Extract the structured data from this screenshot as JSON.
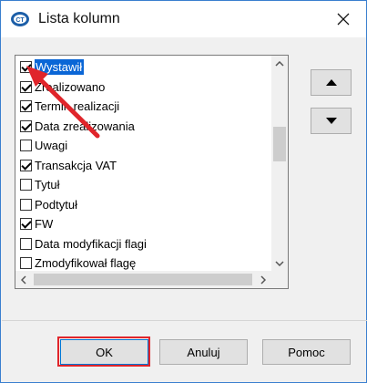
{
  "window": {
    "title": "Lista kolumn"
  },
  "columns": [
    {
      "label": "Wystawił",
      "checked": true,
      "selected": true
    },
    {
      "label": "Zrealizowano",
      "checked": true,
      "selected": false
    },
    {
      "label": "Termin realizacji",
      "checked": true,
      "selected": false
    },
    {
      "label": "Data zrealizowania",
      "checked": true,
      "selected": false
    },
    {
      "label": "Uwagi",
      "checked": false,
      "selected": false
    },
    {
      "label": "Transakcja VAT",
      "checked": true,
      "selected": false
    },
    {
      "label": "Tytuł",
      "checked": false,
      "selected": false
    },
    {
      "label": "Podtytuł",
      "checked": false,
      "selected": false
    },
    {
      "label": "FW",
      "checked": true,
      "selected": false
    },
    {
      "label": "Data modyfikacji flagi",
      "checked": false,
      "selected": false
    },
    {
      "label": "Zmodyfikował flagę",
      "checked": false,
      "selected": false
    }
  ],
  "buttons": {
    "ok": "OK",
    "cancel": "Anuluj",
    "help": "Pomoc"
  },
  "icons": {
    "app": "app-logo-icon",
    "close": "close-icon",
    "move_up": "triangle-up-icon",
    "move_down": "triangle-down-icon"
  },
  "colors": {
    "selection": "#0a66d6",
    "annotation": "#e0252b",
    "window_border": "#3a7fcf"
  }
}
